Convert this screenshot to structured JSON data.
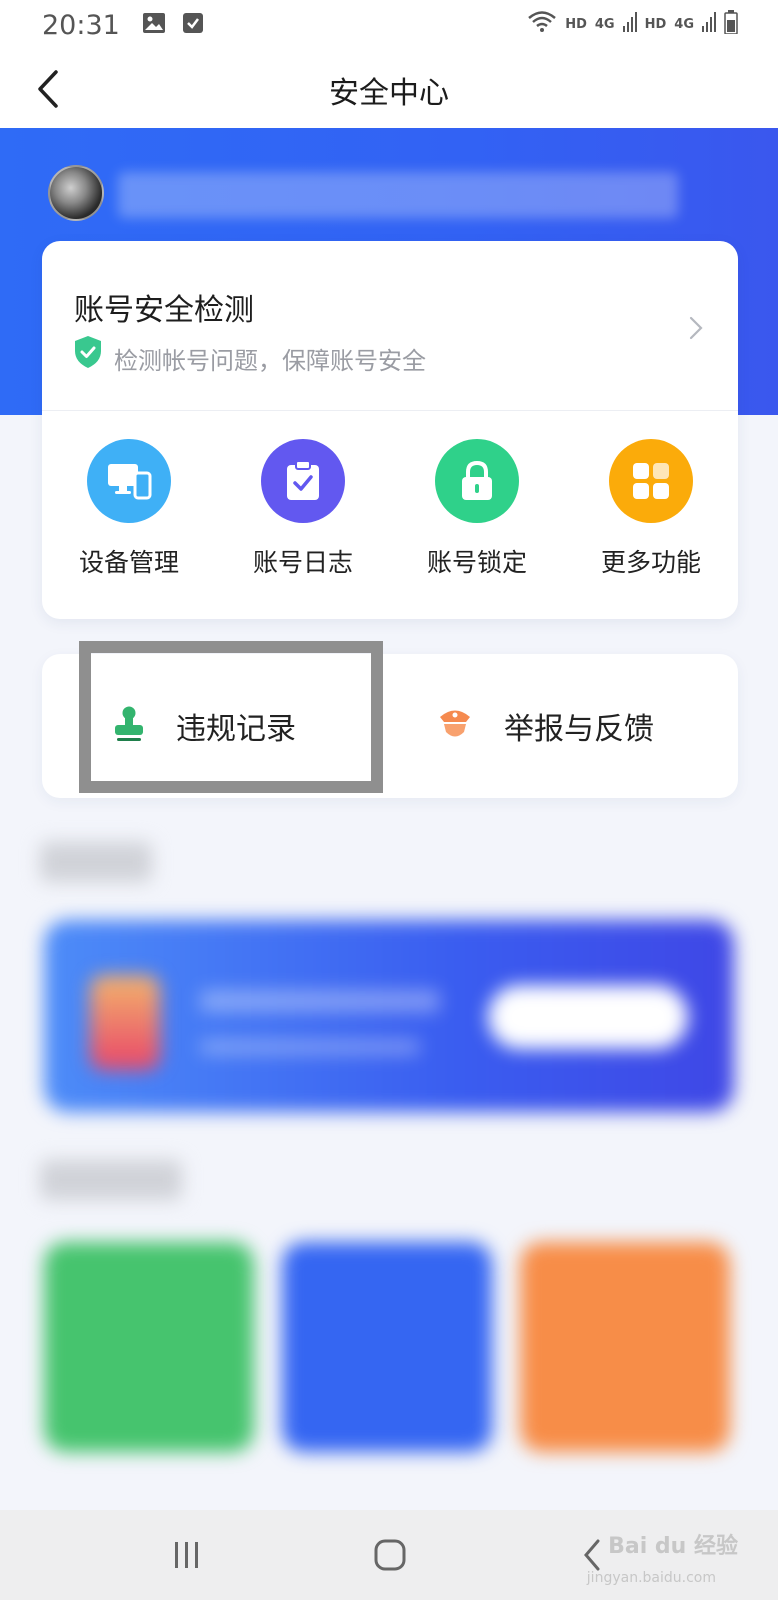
{
  "status_bar": {
    "time": "20:31",
    "icons": [
      "image-icon",
      "check-box-icon",
      "wifi-icon",
      "signal-icon",
      "battery-icon"
    ],
    "network": [
      "HD",
      "4G",
      "HD",
      "4G"
    ]
  },
  "nav": {
    "title": "安全中心",
    "back_icon": "chevron-left-icon"
  },
  "security_check": {
    "title": "账号安全检测",
    "subtitle": "检测帐号问题，保障账号安全",
    "icon": "shield-check-icon"
  },
  "quick_actions": [
    {
      "label": "设备管理",
      "icon": "devices-icon",
      "color": "#3fb0f6"
    },
    {
      "label": "账号日志",
      "icon": "clipboard-check-icon",
      "color": "#6258f0"
    },
    {
      "label": "账号锁定",
      "icon": "lock-icon",
      "color": "#2fd18a"
    },
    {
      "label": "更多功能",
      "icon": "grid-icon",
      "color": "#fbab0a"
    }
  ],
  "actions": [
    {
      "label": "违规记录",
      "icon": "stamp-icon",
      "color": "#33b46e"
    },
    {
      "label": "举报与反馈",
      "icon": "police-cap-icon",
      "color": "#f58a4f"
    }
  ],
  "colors": {
    "accent": "#2f6bf6",
    "highlight_border": "#8f8f8f"
  },
  "system_nav": {
    "icons": [
      "recent-apps-icon",
      "home-icon",
      "back-icon"
    ]
  },
  "watermark": {
    "text": "Bai du 经验",
    "sub": "jingyan.baidu.com"
  }
}
